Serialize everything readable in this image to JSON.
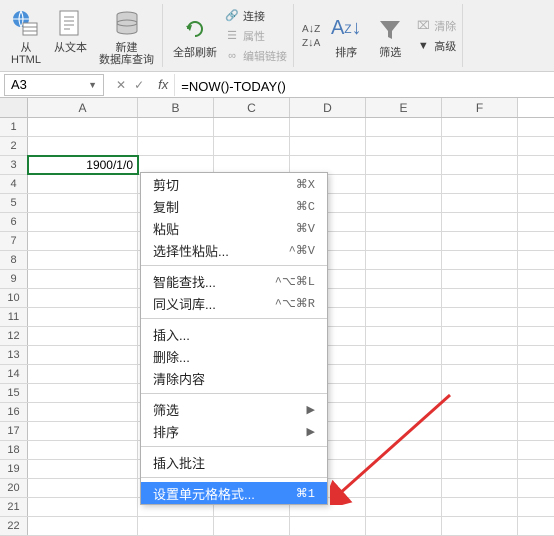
{
  "ribbon": {
    "from_html": "从\nHTML",
    "from_text": "从文本",
    "new_db_query": "新建\n数据库查询",
    "refresh_all": "全部刷新",
    "connections": "连接",
    "properties": "属性",
    "edit_links": "编辑链接",
    "sort": "排序",
    "filter": "筛选",
    "clear": "清除",
    "advanced": "高级"
  },
  "name_box": "A3",
  "formula": "=NOW()-TODAY()",
  "columns": [
    "A",
    "B",
    "C",
    "D",
    "E",
    "F"
  ],
  "selected_cell_value": "1900/1/0",
  "menu": {
    "cut": {
      "label": "剪切",
      "shortcut": "⌘X"
    },
    "copy": {
      "label": "复制",
      "shortcut": "⌘C"
    },
    "paste": {
      "label": "粘贴",
      "shortcut": "⌘V"
    },
    "paste_special": {
      "label": "选择性粘贴...",
      "shortcut": "^⌘V"
    },
    "smart_lookup": {
      "label": "智能查找...",
      "shortcut": "^⌥⌘L"
    },
    "thesaurus": {
      "label": "同义词库...",
      "shortcut": "^⌥⌘R"
    },
    "insert": {
      "label": "插入..."
    },
    "delete": {
      "label": "删除..."
    },
    "clear_contents": {
      "label": "清除内容"
    },
    "filter_m": {
      "label": "筛选"
    },
    "sort_m": {
      "label": "排序"
    },
    "insert_comment": {
      "label": "插入批注"
    },
    "format_cells": {
      "label": "设置单元格格式...",
      "shortcut": "⌘1"
    }
  }
}
